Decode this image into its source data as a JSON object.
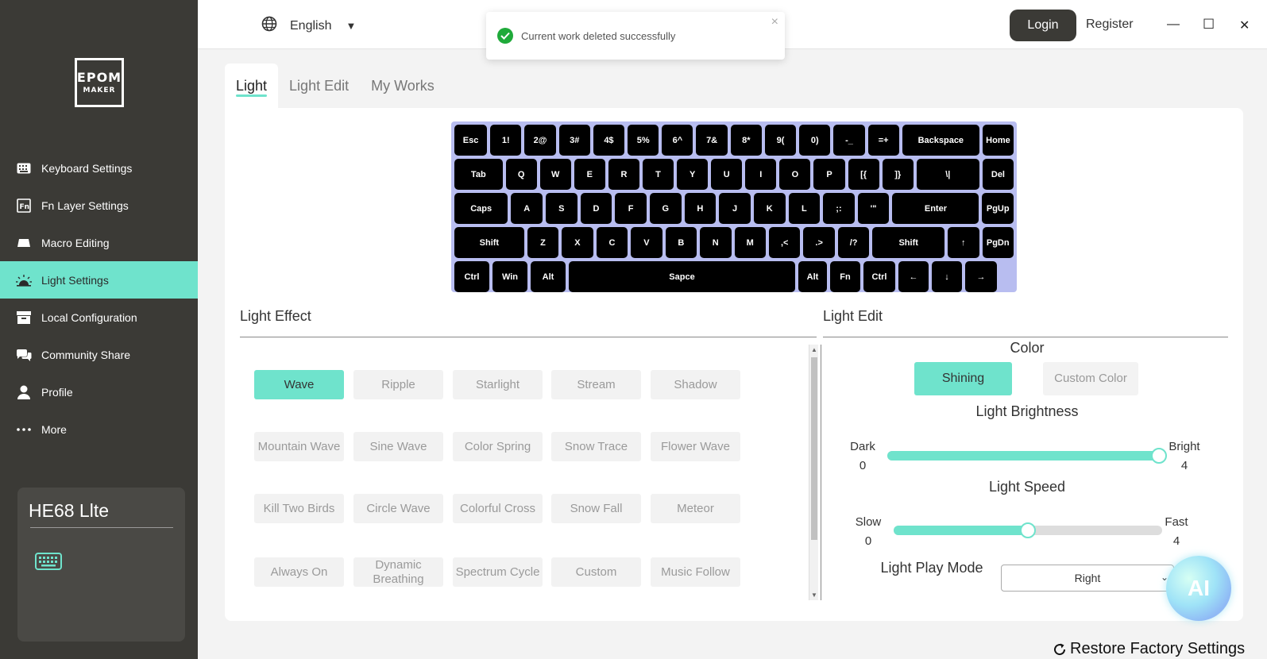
{
  "app": {
    "brand_line1": "EPOM",
    "brand_line2": "MAKER"
  },
  "sidebar": {
    "items": [
      {
        "label": "Keyboard Settings",
        "icon": "keyboard-icon"
      },
      {
        "label": "Fn Layer Settings",
        "icon": "fn-icon"
      },
      {
        "label": "Macro Editing",
        "icon": "macro-icon"
      },
      {
        "label": "Light Settings",
        "icon": "light-icon",
        "active": true
      },
      {
        "label": "Local Configuration",
        "icon": "archive-icon"
      },
      {
        "label": "Community Share",
        "icon": "chat-icon"
      },
      {
        "label": "Profile",
        "icon": "user-icon"
      },
      {
        "label": "More",
        "icon": "more-icon"
      }
    ],
    "device": {
      "name": "HE68 Llte"
    }
  },
  "topbar": {
    "language": "English",
    "toast": "Current work deleted successfully",
    "login": "Login",
    "register": "Register",
    "minimize": "—",
    "maximize": "☐",
    "close": "✕"
  },
  "tabs": [
    "Light",
    "Light Edit",
    "My Works"
  ],
  "keyboard": {
    "rows": [
      [
        "Esc",
        "1!",
        "2@",
        "3#",
        "4$",
        "5%",
        "6^",
        "7&",
        "8*",
        "9(",
        "0)",
        "-_",
        "=+",
        "Backspace",
        "Home"
      ],
      [
        "Tab",
        "Q",
        "W",
        "E",
        "R",
        "T",
        "Y",
        "U",
        "I",
        "O",
        "P",
        "[{",
        "]}",
        "\\|",
        "Del"
      ],
      [
        "Caps",
        "A",
        "S",
        "D",
        "F",
        "G",
        "H",
        "J",
        "K",
        "L",
        ";:",
        "'\"",
        "Enter",
        "PgUp"
      ],
      [
        "Shift",
        "Z",
        "X",
        "C",
        "V",
        "B",
        "N",
        "M",
        ",<",
        ".>",
        "/?",
        "Shift",
        "↑",
        "PgDn"
      ],
      [
        "Ctrl",
        "Win",
        "Alt",
        "Sapce",
        "Alt",
        "Fn",
        "Ctrl",
        "←",
        "↓",
        "→"
      ]
    ]
  },
  "light_effect": {
    "title": "Light Effect",
    "effects": [
      "Wave",
      "Ripple",
      "Starlight",
      "Stream",
      "Shadow",
      "Mountain Wave",
      "Sine Wave",
      "Color Spring",
      "Snow Trace",
      "Flower Wave",
      "Kill Two Birds",
      "Circle Wave",
      "Colorful Cross",
      "Snow Fall",
      "Meteor",
      "Always On",
      "Dynamic Breathing",
      "Spectrum Cycle",
      "Custom",
      "Music Follow"
    ],
    "selected": "Wave"
  },
  "light_edit": {
    "title": "Light Edit",
    "color_title": "Color",
    "color_modes": [
      "Shining",
      "Custom Color"
    ],
    "brightness": {
      "title": "Light Brightness",
      "min_label": "Dark",
      "max_label": "Bright",
      "min": "0",
      "max": "4",
      "value_fraction": 1.0
    },
    "speed": {
      "title": "Light Speed",
      "min_label": "Slow",
      "max_label": "Fast",
      "min": "0",
      "max": "4",
      "value_fraction": 0.5
    },
    "play_mode_label": "Light Play Mode",
    "play_mode_value": "Right"
  },
  "ai_badge": "AI",
  "restore": "Restore Factory Settings",
  "colors": {
    "accent": "#6fe3cc",
    "sidebar": "#3b3a36",
    "keycap": "#000000",
    "keyboard_border": "#b8bdf0"
  }
}
